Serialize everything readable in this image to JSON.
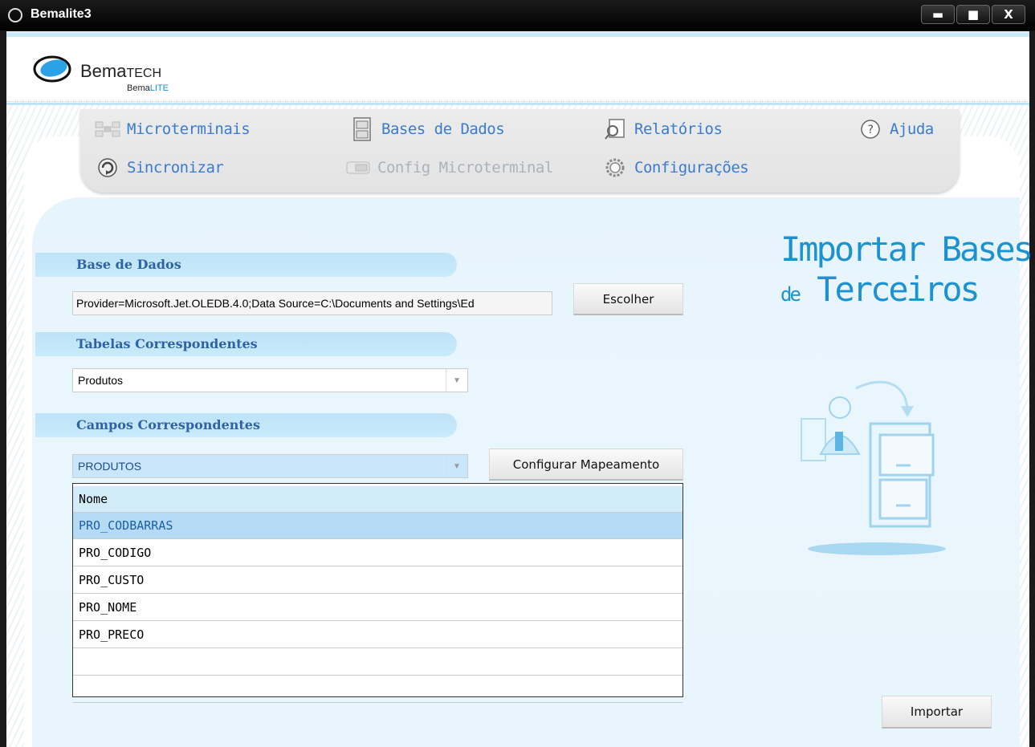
{
  "window": {
    "title": "Bemalite3",
    "minimize": "▬",
    "maximize": "■",
    "close": "X"
  },
  "brand": {
    "name_prefix": "Bema",
    "name_suffix": "TECH",
    "sub_prefix": "Bema",
    "sub_suffix": "LITE"
  },
  "menu": {
    "microterminais": "Microterminais",
    "bases": "Bases de Dados",
    "relatorios": "Relatórios",
    "ajuda": "Ajuda",
    "sincronizar": "Sincronizar",
    "config_micro": "Config Microterminal",
    "configuracoes": "Configurações"
  },
  "sections": {
    "base": "Base de Dados",
    "tabelas": "Tabelas Correspondentes",
    "campos": "Campos Correspondentes"
  },
  "base_dados": {
    "value": "Provider=Microsoft.Jet.OLEDB.4.0;Data Source=C:\\Documents and Settings\\Ed",
    "choose": "Escolher"
  },
  "tabelas": {
    "selected": "Produtos"
  },
  "campos": {
    "selected": "PRODUTOS",
    "config_button": "Configurar Mapeamento"
  },
  "grid": {
    "header": "Nome",
    "rows": [
      "PRO_CODBARRAS",
      "PRO_CODIGO",
      "PRO_CUSTO",
      "PRO_NOME",
      "PRO_PRECO",
      "",
      ""
    ],
    "selected_index": 0
  },
  "heading": {
    "line1": "Importar Bases",
    "de": "de",
    "line2": "Terceiros"
  },
  "importar": "Importar"
}
